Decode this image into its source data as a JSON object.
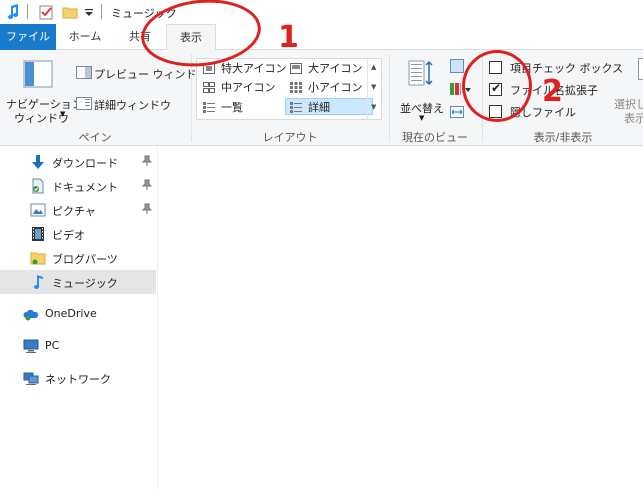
{
  "window": {
    "title": "ミュージック"
  },
  "tabs": {
    "file": "ファイル",
    "home": "ホーム",
    "share": "共有",
    "view": "表示"
  },
  "ribbon": {
    "pane": {
      "nav_pane_line1": "ナビゲーション",
      "nav_pane_line2": "ウィンドウ",
      "preview": "プレビュー ウィンドウ",
      "details": "詳細ウィンドウ",
      "label": "ペイン"
    },
    "layout": {
      "extra_large": "特大アイコン",
      "large": "大アイコン",
      "medium": "中アイコン",
      "small": "小アイコン",
      "list": "一覧",
      "details": "詳細",
      "label": "レイアウト"
    },
    "current_view": {
      "sort": "並べ替え",
      "label": "現在のビュー"
    },
    "show_hide": {
      "item_checkbox": "項目チェック ボックス",
      "file_ext": "ファイル名拡張子",
      "hidden": "隠しファイル",
      "hide_selected_line1": "選択し",
      "hide_selected_line2": "表示",
      "label": "表示/非表示",
      "item_checkbox_checked": false,
      "file_ext_checked": true,
      "hidden_checked": false
    }
  },
  "nav": {
    "items": [
      {
        "label": "ダウンロード",
        "icon": "download-icon",
        "pinned": true
      },
      {
        "label": "ドキュメント",
        "icon": "documents-icon",
        "pinned": true
      },
      {
        "label": "ピクチャ",
        "icon": "pictures-icon",
        "pinned": true
      },
      {
        "label": "ビデオ",
        "icon": "video-icon",
        "pinned": false
      },
      {
        "label": "ブログパーツ",
        "icon": "folder-icon",
        "pinned": false
      },
      {
        "label": "ミュージック",
        "icon": "music-icon",
        "pinned": false,
        "selected": true
      }
    ],
    "onedrive": "OneDrive",
    "pc": "PC",
    "network": "ネットワーク"
  },
  "annotations": {
    "step1": "1",
    "step2": "2"
  },
  "colors": {
    "accent": "#1979ca",
    "annotation": "#e0201f",
    "selection": "#cce8ff"
  }
}
